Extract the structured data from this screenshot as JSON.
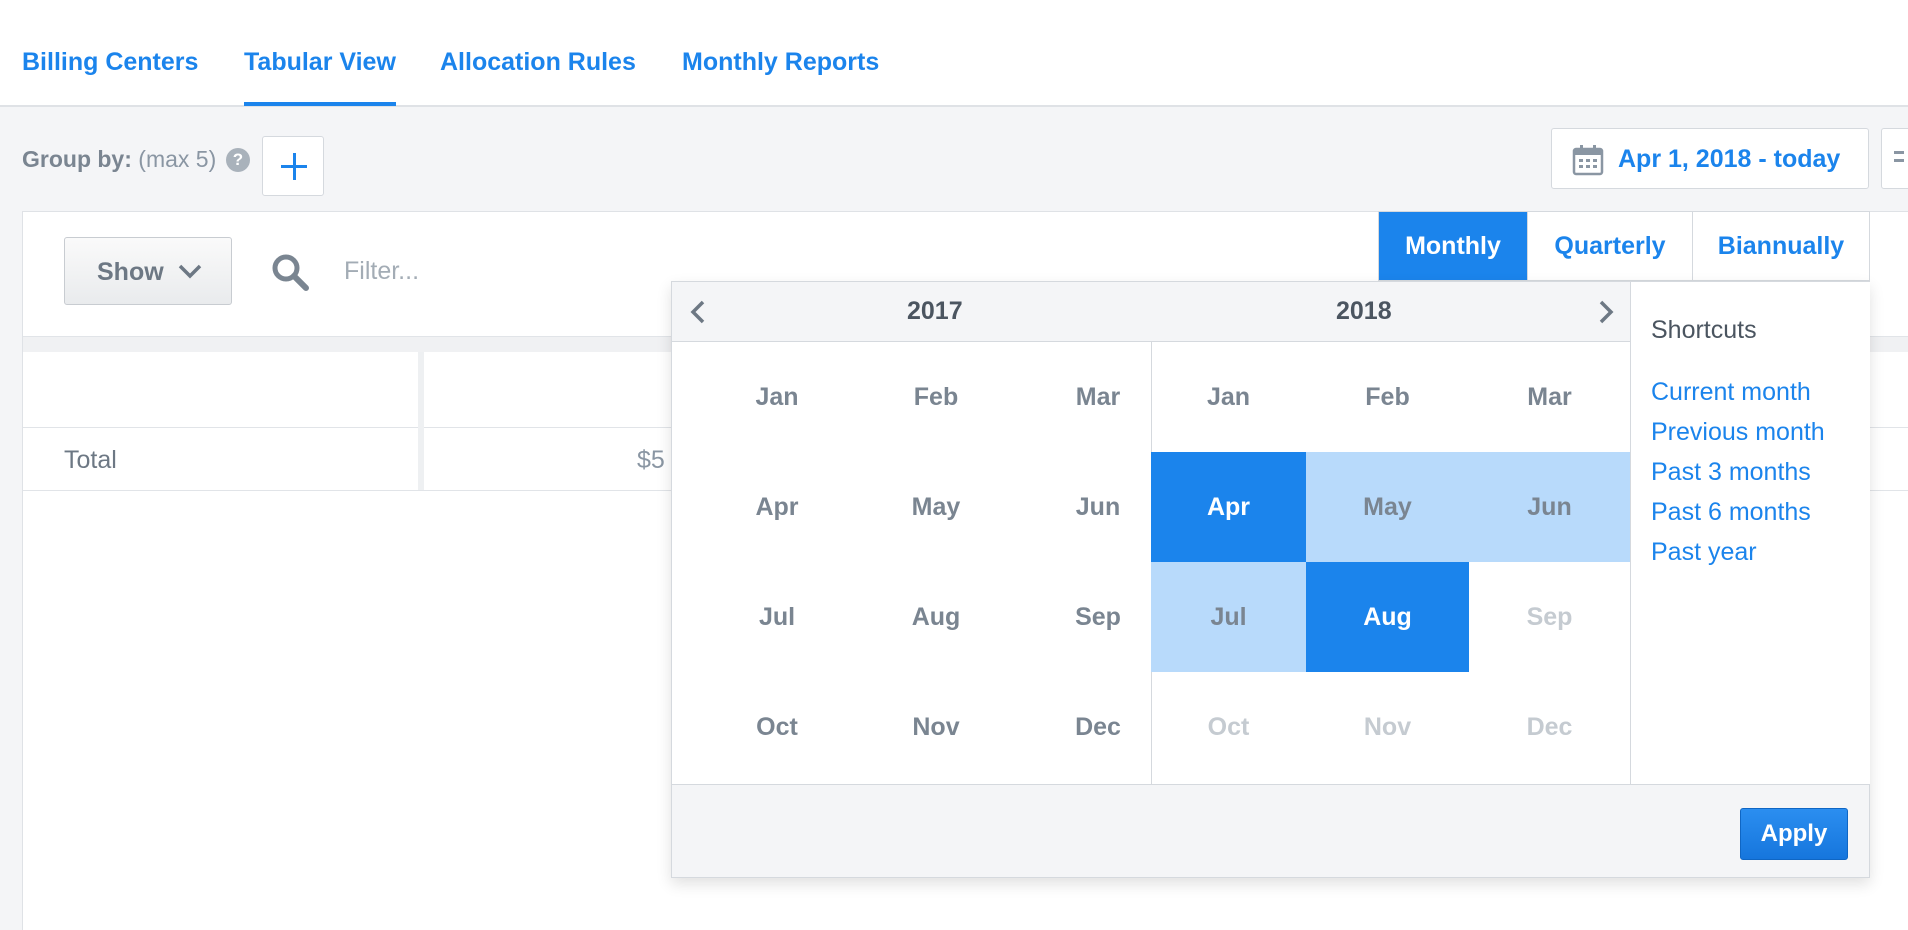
{
  "nav": {
    "tabs": [
      {
        "label": "Billing Centers"
      },
      {
        "label": "Tabular View"
      },
      {
        "label": "Allocation Rules"
      },
      {
        "label": "Monthly Reports"
      }
    ],
    "active": "Tabular View"
  },
  "groupby": {
    "label": "Group by:",
    "hint": "(max 5)",
    "help": "?"
  },
  "daterange": {
    "label": "Apr 1, 2018 - today"
  },
  "toolbar": {
    "show_label": "Show",
    "filter_placeholder": "Filter..."
  },
  "table": {
    "total_label": "Total",
    "total_value_visible": "$5"
  },
  "period_tabs": [
    {
      "label": "Monthly",
      "active": true
    },
    {
      "label": "Quarterly",
      "active": false
    },
    {
      "label": "Biannually",
      "active": false
    }
  ],
  "calendar": {
    "years": [
      {
        "year": "2017",
        "months": [
          {
            "label": "Jan",
            "state": "normal"
          },
          {
            "label": "Feb",
            "state": "normal"
          },
          {
            "label": "Mar",
            "state": "normal"
          },
          {
            "label": "Apr",
            "state": "normal"
          },
          {
            "label": "May",
            "state": "normal"
          },
          {
            "label": "Jun",
            "state": "normal"
          },
          {
            "label": "Jul",
            "state": "normal"
          },
          {
            "label": "Aug",
            "state": "normal"
          },
          {
            "label": "Sep",
            "state": "normal"
          },
          {
            "label": "Oct",
            "state": "normal"
          },
          {
            "label": "Nov",
            "state": "normal"
          },
          {
            "label": "Dec",
            "state": "normal"
          }
        ]
      },
      {
        "year": "2018",
        "months": [
          {
            "label": "Jan",
            "state": "normal"
          },
          {
            "label": "Feb",
            "state": "normal"
          },
          {
            "label": "Mar",
            "state": "normal"
          },
          {
            "label": "Apr",
            "state": "selected"
          },
          {
            "label": "May",
            "state": "in-range"
          },
          {
            "label": "Jun",
            "state": "in-range"
          },
          {
            "label": "Jul",
            "state": "in-range"
          },
          {
            "label": "Aug",
            "state": "selected"
          },
          {
            "label": "Sep",
            "state": "disabled"
          },
          {
            "label": "Oct",
            "state": "disabled"
          },
          {
            "label": "Nov",
            "state": "disabled"
          },
          {
            "label": "Dec",
            "state": "disabled"
          }
        ]
      }
    ],
    "shortcuts_title": "Shortcuts",
    "shortcuts": [
      "Current month",
      "Previous month",
      "Past 3 months",
      "Past 6 months",
      "Past year"
    ],
    "apply_label": "Apply"
  },
  "colors": {
    "accent": "#1b84ec",
    "range": "#b8dafb",
    "muted_text": "#7a8591",
    "disabled_text": "#c5cbd1"
  },
  "icons": {
    "calendar": "calendar-icon",
    "search": "search-icon",
    "chevron": "chevron-down-icon",
    "prev": "chevron-left-icon",
    "next": "chevron-right-icon",
    "help": "help-icon",
    "add": "plus-icon"
  }
}
